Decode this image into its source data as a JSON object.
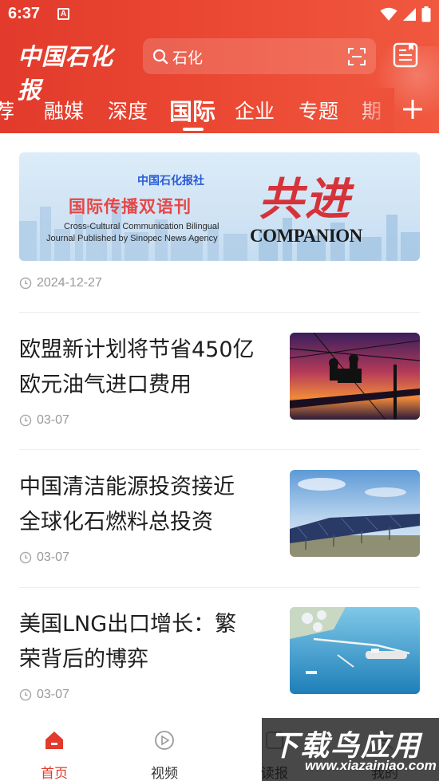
{
  "status_bar": {
    "time": "6:37",
    "notification_letter": "A"
  },
  "header": {
    "logo_text": "中国石化报",
    "search_text": "石化",
    "tabs": [
      "荐",
      "融媒",
      "深度",
      "国际",
      "企业",
      "专题",
      "期"
    ],
    "active_tab": "国际"
  },
  "banner": {
    "sub_title": "中国石化报社",
    "main_title": "国际传播双语刊",
    "en_line1": "Cross-Cultural Communication Bilingual",
    "en_line2": "Journal Published by Sinopec News Agency",
    "brand_cjk": "共进",
    "brand_en": "COMPANION",
    "date": "2024-12-27"
  },
  "news": [
    {
      "title_line1": "欧盟新计划将节省450亿",
      "title_line2": "欧元油气进口费用",
      "date": "03-07",
      "image": "power-line-workers-sunset"
    },
    {
      "title_line1": "中国清洁能源投资接近",
      "title_line2": "全球化石燃料总投资",
      "date": "03-07",
      "image": "solar-panels-field"
    },
    {
      "title_line1": "美国LNG出口增长：繁",
      "title_line2": "荣背后的博弈",
      "date": "03-07",
      "image": "lng-port-aerial"
    }
  ],
  "bottom_nav": {
    "items": [
      "首页",
      "视频",
      "读报",
      "我的"
    ],
    "active_color": "#e23a2c"
  },
  "watermark": {
    "title": "下载鸟应用",
    "url": "www.xiazainiao.com"
  },
  "colors": {
    "brand_red": "#e23a2c",
    "meta_gray": "#999999"
  }
}
